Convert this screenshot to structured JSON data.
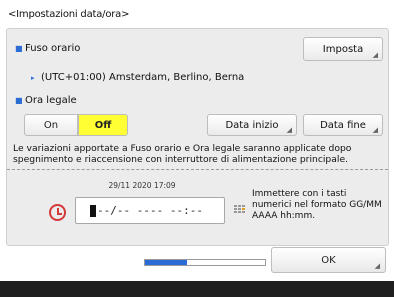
{
  "title": "<Impostazioni data/ora>",
  "time_zone": {
    "label": "Fuso orario",
    "set_button": "Imposta",
    "value": "(UTC+01:00) Amsterdam, Berlino, Berna"
  },
  "dst": {
    "label": "Ora legale",
    "on_label": "On",
    "off_label": "Off",
    "selected": "Off",
    "start_date_button": "Data inizio",
    "end_date_button": "Data fine"
  },
  "note": "Le variazioni apportate a Fuso orario e Ora legale saranno applicate dopo spegnimento e riaccensione con interruttore di alimentazione principale.",
  "datetime": {
    "current": "29/11 2020 17:09",
    "input_value": "--/-- ---- --:--"
  },
  "hint": "Immettere con i tasti numerici nel formato GG/MM AAAA hh:mm.",
  "progress_fraction": 0.35,
  "ok_button": "OK",
  "colors": {
    "accent": "#2a6bd6",
    "selected": "#ffff33",
    "icon_red": "#d23a3a"
  },
  "icons": [
    "clock-icon",
    "keypad-icon",
    "bullet-icon"
  ]
}
